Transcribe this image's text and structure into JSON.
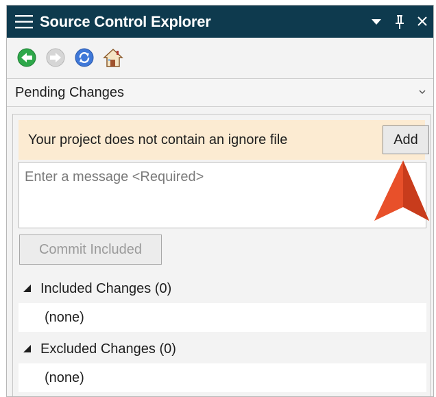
{
  "window": {
    "title": "Source Control Explorer",
    "title_bar_color": "#0e3a4e",
    "controls": {
      "dropdown": "triangle-down-icon",
      "pin": "pin-icon",
      "close": "close-icon"
    }
  },
  "toolbar": {
    "back": "back-arrow-icon",
    "forward": "forward-arrow-icon",
    "refresh": "refresh-icon",
    "home": "home-icon"
  },
  "view_selector": {
    "selected": "Pending Changes"
  },
  "notice": {
    "text": "Your project does not contain an ignore file",
    "button": "Add",
    "color": "#fcebd2"
  },
  "commit": {
    "message_placeholder": "Enter a message <Required>",
    "button": "Commit Included"
  },
  "sections": [
    {
      "title": "Included Changes",
      "count": "(0)",
      "items": [
        "(none)"
      ]
    },
    {
      "title": "Excluded Changes",
      "count": "(0)",
      "items": [
        "(none)"
      ]
    }
  ],
  "annotation": {
    "pointer_color": "#e8502a"
  }
}
